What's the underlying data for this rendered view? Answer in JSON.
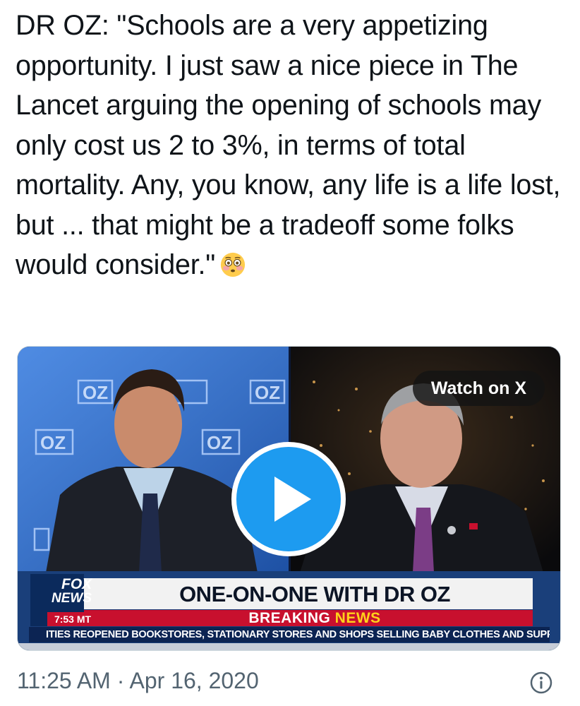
{
  "tweet": {
    "text": "DR OZ: \"Schools are a very appetizing opportunity. I just saw a nice piece in The Lancet arguing the opening of schools may only cost us 2 to 3%, in terms of total mortality. Any, you know, any life is a life lost, but ... that might be a tradeoff some folks would consider.\"",
    "emoji": "flushed-face-emoji",
    "timestamp": "11:25 AM · Apr 16, 2020"
  },
  "video": {
    "watch_label": "Watch on X",
    "play_icon": "play-icon",
    "lower_third": {
      "title": "ONE-ON-ONE WITH DR OZ",
      "breaking_word": "BREAKING",
      "news_word": "NEWS",
      "ticker": "ITIES REOPENED BOOKSTORES, STATIONARY STORES AND SHOPS SELLING BABY CLOTHES AND SUPPLIES N",
      "network_line1": "FOX",
      "network_line2": "NEWS",
      "clock": "7:53 MT"
    },
    "backdrop_logo": "OZ"
  },
  "colors": {
    "accent": "#1d9bf0",
    "muted": "#536471",
    "breaking_red": "#c8102e",
    "news_yellow": "#ffd21a"
  },
  "icons": {
    "info": "info-icon"
  }
}
